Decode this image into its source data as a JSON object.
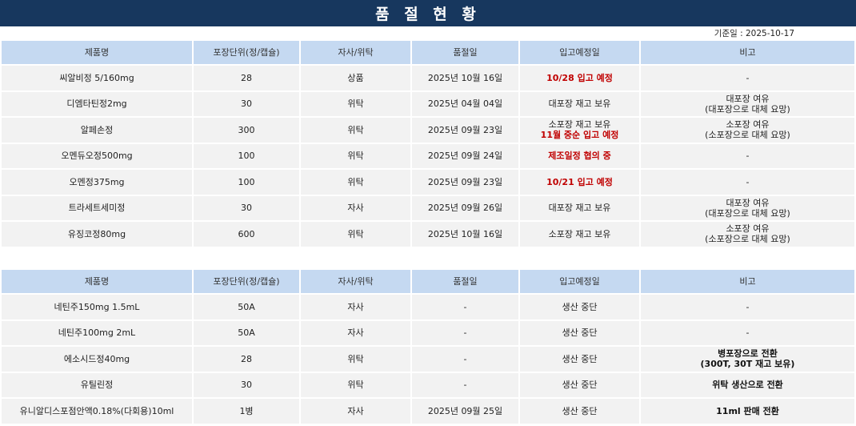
{
  "title": "품 절 현 황",
  "base_date": "기준일 : 2025-10-17",
  "columns": [
    "제품명",
    "포장단위(정/캡슐)",
    "자사/위탁",
    "품절일",
    "입고예정일",
    "비고"
  ],
  "table1": [
    {
      "name": "씨알비정 5/160mg",
      "pack": "28",
      "type": "상품",
      "date": "2025년 10월 16일",
      "eta": [
        "10/28 입고 예정"
      ],
      "eta_style": [
        "red"
      ],
      "note": [
        "-"
      ],
      "note_style": "normal"
    },
    {
      "name": "디엠타틴정2mg",
      "pack": "30",
      "type": "위탁",
      "date": "2025년 04월 04일",
      "eta": [
        "대포장 재고 보유"
      ],
      "eta_style": [
        "normal"
      ],
      "note": [
        "대포장 여유",
        "(대포장으로 대체 요망)"
      ],
      "note_style": "normal"
    },
    {
      "name": "알페손정",
      "pack": "300",
      "type": "위탁",
      "date": "2025년 09월 23일",
      "eta": [
        "소포장 재고 보유",
        "11월 중순 입고 예정"
      ],
      "eta_style": [
        "normal",
        "red"
      ],
      "note": [
        "소포장 여유",
        "(소포장으로 대체 요망)"
      ],
      "note_style": "normal"
    },
    {
      "name": "오멘듀오정500mg",
      "pack": "100",
      "type": "위탁",
      "date": "2025년 09월 24일",
      "eta": [
        "제조일정 협의 중"
      ],
      "eta_style": [
        "red"
      ],
      "note": [
        "-"
      ],
      "note_style": "normal"
    },
    {
      "name": "오멘정375mg",
      "pack": "100",
      "type": "위탁",
      "date": "2025년 09월 23일",
      "eta": [
        "10/21 입고 예정"
      ],
      "eta_style": [
        "red"
      ],
      "note": [
        "-"
      ],
      "note_style": "normal"
    },
    {
      "name": "트라세트세미정",
      "pack": "30",
      "type": "자사",
      "date": "2025년 09월 26일",
      "eta": [
        "대포장 재고 보유"
      ],
      "eta_style": [
        "normal"
      ],
      "note": [
        "대포장 여유",
        "(대포장으로 대체 요망)"
      ],
      "note_style": "normal"
    },
    {
      "name": "유징코정80mg",
      "pack": "600",
      "type": "위탁",
      "date": "2025년 10월 16일",
      "eta": [
        "소포장 재고 보유"
      ],
      "eta_style": [
        "normal"
      ],
      "note": [
        "소포장 여유",
        "(소포장으로 대체 요망)"
      ],
      "note_style": "normal"
    }
  ],
  "table2": [
    {
      "name": "네틴주150mg 1.5mL",
      "pack": "50A",
      "type": "자사",
      "date": "-",
      "eta": [
        "생산 중단"
      ],
      "eta_style": [
        "normal"
      ],
      "note": [
        "-"
      ],
      "note_style": "normal"
    },
    {
      "name": "네틴주100mg 2mL",
      "pack": "50A",
      "type": "자사",
      "date": "-",
      "eta": [
        "생산 중단"
      ],
      "eta_style": [
        "normal"
      ],
      "note": [
        "-"
      ],
      "note_style": "normal"
    },
    {
      "name": "에소시드정40mg",
      "pack": "28",
      "type": "위탁",
      "date": "-",
      "eta": [
        "생산 중단"
      ],
      "eta_style": [
        "normal"
      ],
      "note": [
        "병포장으로 전환",
        "(300T, 30T 재고 보유)"
      ],
      "note_style": "bold"
    },
    {
      "name": "유틸린정",
      "pack": "30",
      "type": "위탁",
      "date": "-",
      "eta": [
        "생산 중단"
      ],
      "eta_style": [
        "normal"
      ],
      "note": [
        "위탁 생산으로 전환"
      ],
      "note_style": "bold"
    },
    {
      "name": "유니알디스포점안액0.18%(다회용)10ml",
      "pack": "1병",
      "type": "자사",
      "date": "2025년 09월 25일",
      "eta": [
        "생산 중단"
      ],
      "eta_style": [
        "normal"
      ],
      "note": [
        "11ml 판매 전환"
      ],
      "note_style": "bold"
    }
  ],
  "colors": {
    "title_bg": "#17375e",
    "header_bg": "#c5d9f1",
    "row_bg": "#f2f2f2",
    "alert_red": "#c00000"
  }
}
